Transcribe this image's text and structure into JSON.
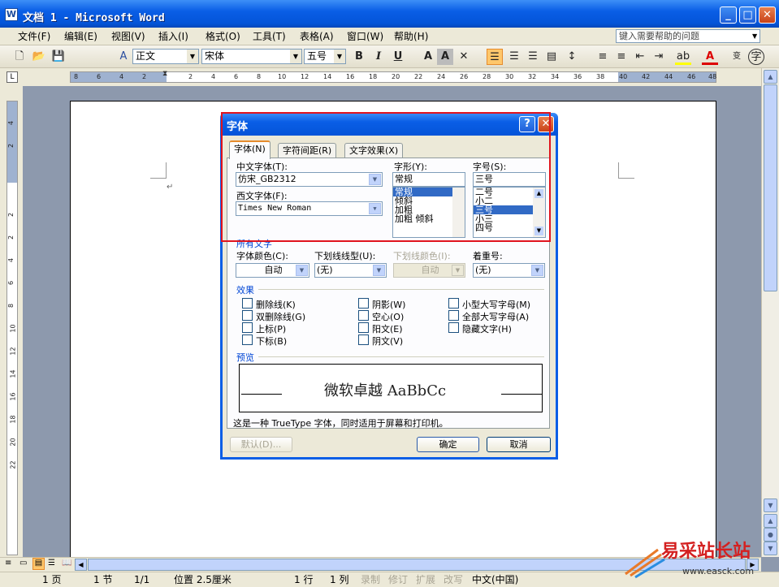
{
  "window": {
    "title": "文档 1 - Microsoft Word"
  },
  "menu": [
    "文件(F)",
    "编辑(E)",
    "视图(V)",
    "插入(I)",
    "格式(O)",
    "工具(T)",
    "表格(A)",
    "窗口(W)",
    "帮助(H)"
  ],
  "help_box": {
    "placeholder": "键入需要帮助的问题"
  },
  "toolbar": {
    "style": "正文",
    "font": "宋体",
    "size": "五号"
  },
  "ruler": {
    "h_ticks": [
      "8",
      "6",
      "4",
      "2",
      "2",
      "4",
      "6",
      "8",
      "10",
      "12",
      "14",
      "16",
      "18",
      "20",
      "22",
      "24",
      "26",
      "28",
      "30",
      "32",
      "34",
      "36",
      "38",
      "40",
      "42",
      "44",
      "46",
      "48"
    ],
    "v_ticks": [
      "4",
      "2",
      "2",
      "2",
      "4",
      "6",
      "8",
      "10",
      "12",
      "14",
      "16",
      "18",
      "20",
      "22"
    ]
  },
  "dialog": {
    "title": "字体",
    "help_btn": "?",
    "tabs": [
      "字体(N)",
      "字符间距(R)",
      "文字效果(X)"
    ],
    "cn_font_label": "中文字体(T):",
    "cn_font_value": "仿宋_GB2312",
    "west_font_label": "西文字体(F):",
    "west_font_value": "Times New Roman",
    "style_label": "字形(Y):",
    "style_value": "常规",
    "style_items": [
      "常规",
      "倾斜",
      "加粗",
      "加粗 倾斜"
    ],
    "size_label": "字号(S):",
    "size_value": "三号",
    "size_items": [
      "二号",
      "小二",
      "三号",
      "小三",
      "四号"
    ],
    "all_text_section": "所有文字",
    "color_label": "字体颜色(C):",
    "color_value": "自动",
    "underline_label": "下划线线型(U):",
    "underline_value": "(无)",
    "underline_color_label": "下划线颜色(I):",
    "underline_color_value": "自动",
    "emphasis_label": "着重号:",
    "emphasis_value": "(无)",
    "effects_section": "效果",
    "effects": [
      "删除线(K)",
      "双删除线(G)",
      "上标(P)",
      "下标(B)",
      "阴影(W)",
      "空心(O)",
      "阳文(E)",
      "阴文(V)",
      "小型大写字母(M)",
      "全部大写字母(A)",
      "隐藏文字(H)"
    ],
    "preview_section": "预览",
    "preview_text": "微软卓越 AaBbCc",
    "note": "这是一种 TrueType 字体，同时适用于屏幕和打印机。",
    "default_btn": "默认(D)...",
    "ok_btn": "确定",
    "cancel_btn": "取消"
  },
  "status": {
    "page": "1 页",
    "section": "1 节",
    "pages": "1/1",
    "pos": "位置 2.5厘米",
    "line": "1 行",
    "col": "1 列",
    "rec": "录制",
    "trk": "修订",
    "ext": "扩展",
    "ovr": "改写",
    "lang": "中文(中国)"
  },
  "watermark": {
    "brand": "易采站长站",
    "url": "www.easck.com"
  }
}
